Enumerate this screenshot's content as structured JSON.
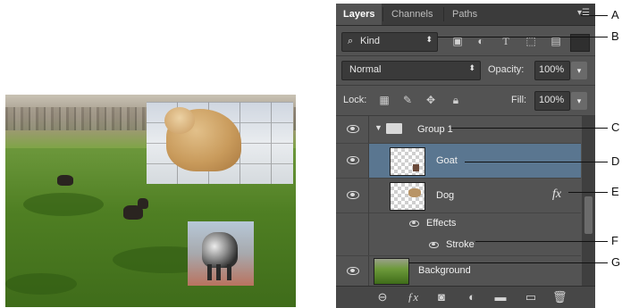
{
  "panel": {
    "tabs": [
      {
        "label": "Layers",
        "active": true
      },
      {
        "label": "Channels",
        "active": false
      },
      {
        "label": "Paths",
        "active": false
      }
    ],
    "filter": {
      "kind_label": "Kind"
    },
    "blend": {
      "mode": "Normal",
      "opacity_label": "Opacity:",
      "opacity_value": "100%"
    },
    "lock": {
      "label": "Lock:",
      "fill_label": "Fill:",
      "fill_value": "100%"
    },
    "layers": {
      "group": "Group 1",
      "goat": "Goat",
      "dog": "Dog",
      "fx": "fx",
      "effects": "Effects",
      "stroke": "Stroke",
      "background": "Background"
    }
  },
  "callouts": [
    "A",
    "B",
    "C",
    "D",
    "E",
    "F",
    "G"
  ],
  "colors": {
    "panel_bg": "#535353",
    "selected_row": "#5a7690",
    "tab_bar": "#3b3b3b"
  }
}
